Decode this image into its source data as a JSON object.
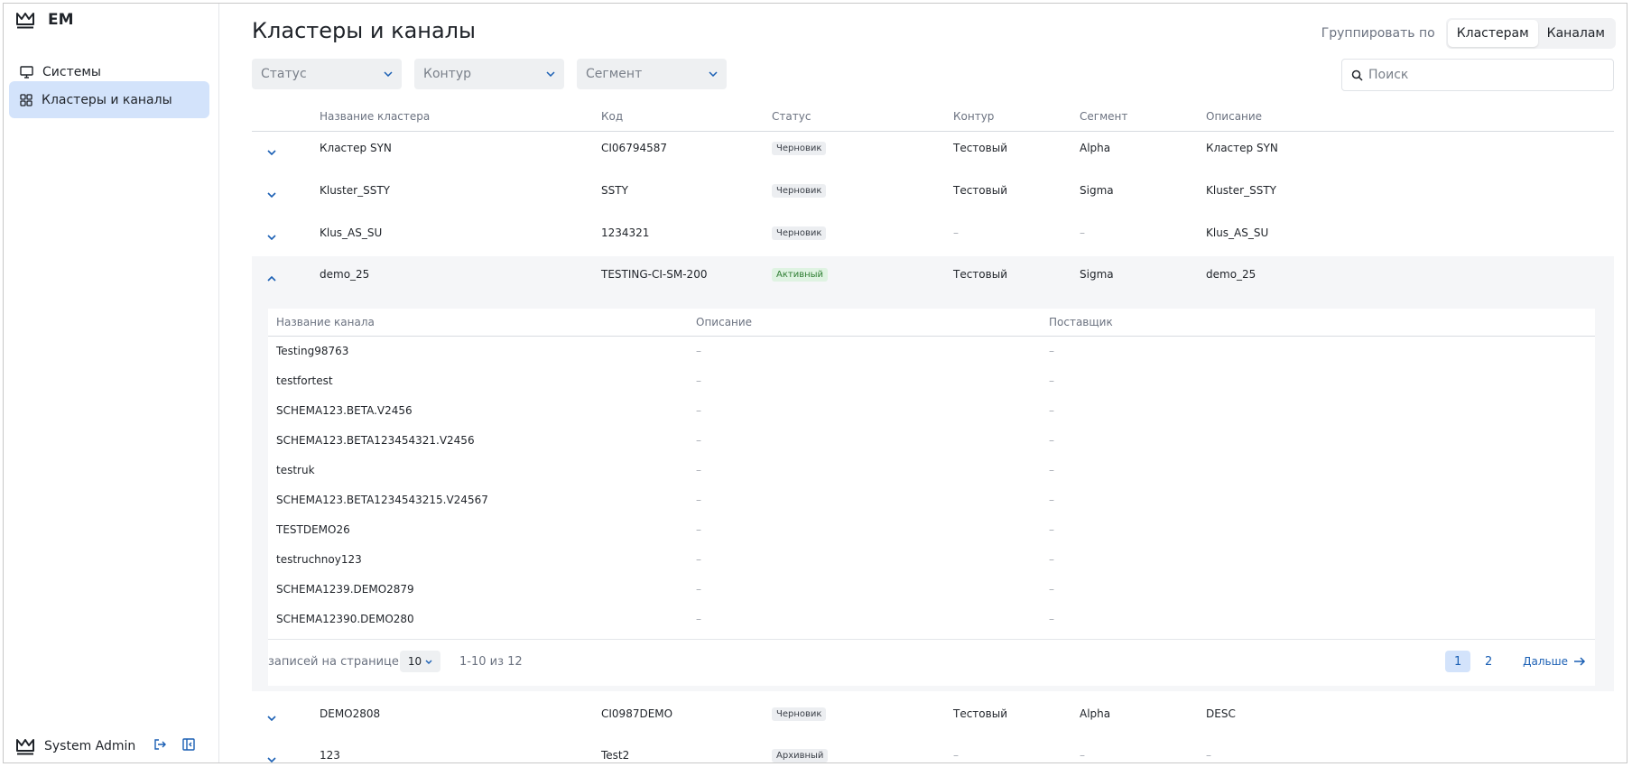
{
  "app": {
    "name": "EM"
  },
  "sidebar": {
    "items": [
      {
        "label": "Системы",
        "icon": "monitor-icon"
      },
      {
        "label": "Кластеры и каналы",
        "icon": "grid-icon"
      }
    ],
    "user": "System Admin"
  },
  "header": {
    "title": "Кластеры и каналы",
    "group_label": "Группировать по",
    "group_options": [
      "Кластерам",
      "Каналам"
    ],
    "group_selected": "Кластерам"
  },
  "filters": [
    "Статус",
    "Контур",
    "Сегмент"
  ],
  "search": {
    "placeholder": "Поиск"
  },
  "table": {
    "columns": [
      "Название кластера",
      "Код",
      "Статус",
      "Контур",
      "Сегмент",
      "Описание"
    ],
    "rows": [
      {
        "name": "Кластер SYN",
        "code": "CI06794587",
        "status": "Черновик",
        "contour": "Тестовый",
        "segment": "Alpha",
        "desc": "Кластер SYN"
      },
      {
        "name": "Kluster_SSTY",
        "code": "SSTY",
        "status": "Черновик",
        "contour": "Тестовый",
        "segment": "Sigma",
        "desc": "Kluster_SSTY"
      },
      {
        "name": "Klus_AS_SU",
        "code": "1234321",
        "status": "Черновик",
        "contour": "–",
        "segment": "–",
        "desc": "Klus_AS_SU"
      },
      {
        "name": "demo_25",
        "code": "TESTING-CI-SM-200",
        "status": "Активный",
        "contour": "Тестовый",
        "segment": "Sigma",
        "desc": "demo_25"
      },
      {
        "name": "DEMO2808",
        "code": "CI0987DEMO",
        "status": "Черновик",
        "contour": "Тестовый",
        "segment": "Alpha",
        "desc": "DESC"
      },
      {
        "name": "123",
        "code": "Test2",
        "status": "Архивный",
        "contour": "–",
        "segment": "–",
        "desc": "–"
      }
    ]
  },
  "subtable": {
    "columns": [
      "Название канала",
      "Описание",
      "Поставщик"
    ],
    "rows": [
      {
        "name": "Testing98763",
        "desc": "–",
        "vendor": "–"
      },
      {
        "name": "testfortest",
        "desc": "–",
        "vendor": "–"
      },
      {
        "name": "SCHEMA123.BETA.V2456",
        "desc": "–",
        "vendor": "–"
      },
      {
        "name": "SCHEMA123.BETA123454321.V2456",
        "desc": "–",
        "vendor": "–"
      },
      {
        "name": "testruk",
        "desc": "–",
        "vendor": "–"
      },
      {
        "name": "SCHEMA123.BETA1234543215.V24567",
        "desc": "–",
        "vendor": "–"
      },
      {
        "name": "TESTDEMO26",
        "desc": "–",
        "vendor": "–"
      },
      {
        "name": "testruchnoy123",
        "desc": "–",
        "vendor": "–"
      },
      {
        "name": "SCHEMA1239.DEMO2879",
        "desc": "–",
        "vendor": "–"
      },
      {
        "name": "SCHEMA12390.DEMO280",
        "desc": "–",
        "vendor": "–"
      }
    ],
    "pager": {
      "per_page_label": "записей на странице",
      "per_page": "10",
      "range": "1-10 из 12",
      "pages": [
        "1",
        "2"
      ],
      "current": "1",
      "next": "Дальше"
    }
  },
  "colors": {
    "accent": "#1a5fb4",
    "active_nav": "#d3e3fb",
    "active_badge": "#dff3e2"
  }
}
